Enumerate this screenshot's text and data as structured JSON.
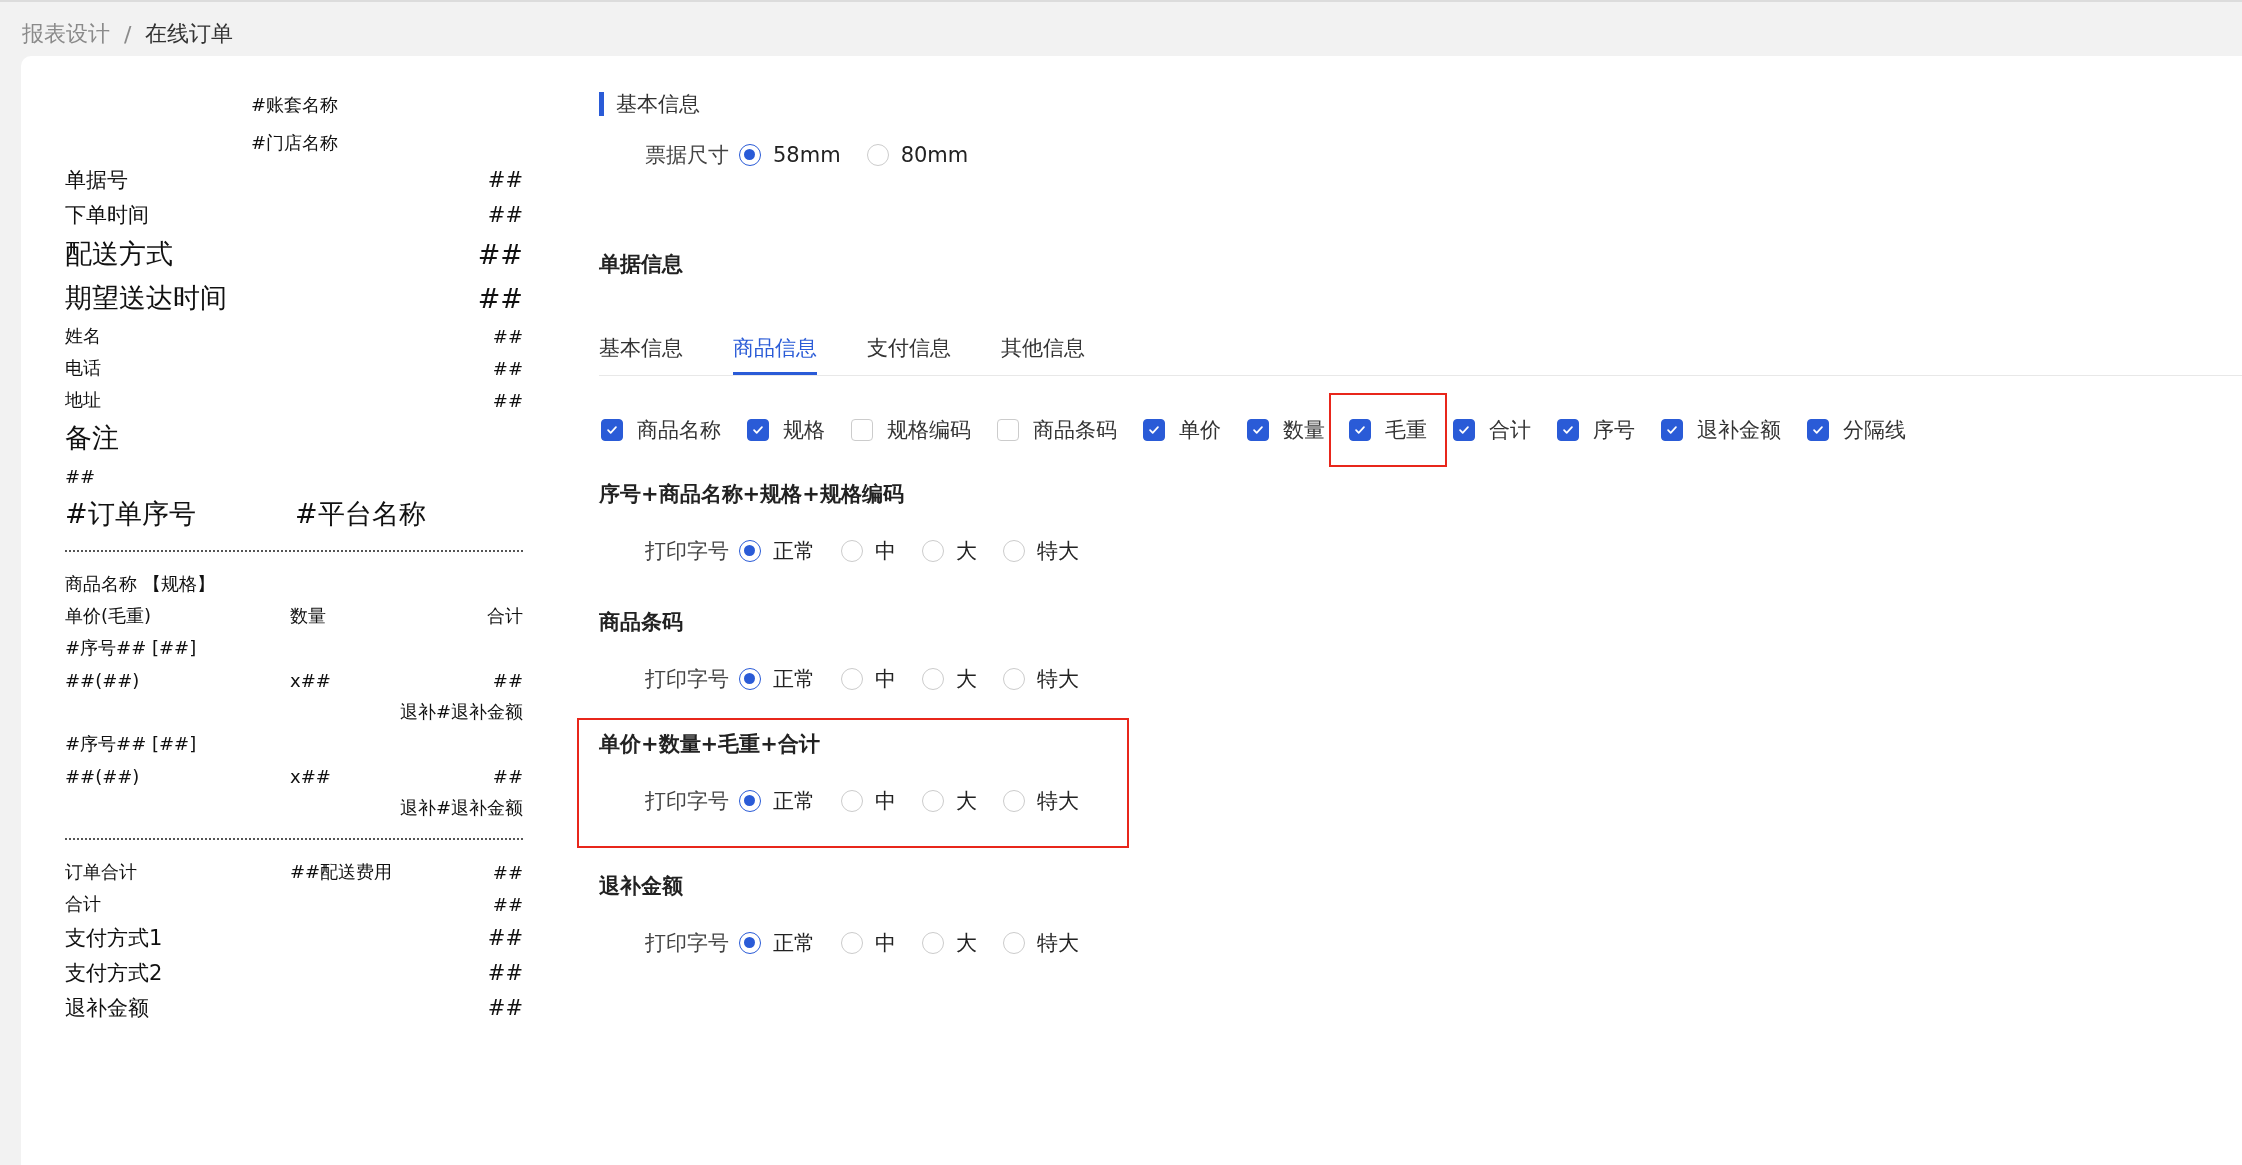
{
  "breadcrumb": [
    {
      "label": "报表设计",
      "current": false,
      "separator": "/"
    },
    {
      "label": "在线订单",
      "current": true
    }
  ],
  "preview": {
    "rows": [
      {
        "kind": "center",
        "large": false,
        "medium": false,
        "cells": [
          "#账套名称"
        ]
      },
      {
        "kind": "center",
        "large": false,
        "medium": false,
        "cells": [
          "#门店名称"
        ]
      },
      {
        "kind": "pair",
        "large": false,
        "medium": true,
        "cells": [
          "单据号",
          "##"
        ]
      },
      {
        "kind": "pair",
        "large": false,
        "medium": true,
        "cells": [
          "下单时间",
          "##"
        ]
      },
      {
        "kind": "pair",
        "large": true,
        "medium": false,
        "cells": [
          "配送方式",
          "##"
        ]
      },
      {
        "kind": "pair",
        "large": true,
        "medium": false,
        "cells": [
          "期望送达时间",
          "##"
        ]
      },
      {
        "kind": "pair",
        "large": false,
        "medium": false,
        "cells": [
          "姓名",
          "##"
        ]
      },
      {
        "kind": "pair",
        "large": false,
        "medium": false,
        "cells": [
          "电话",
          "##"
        ]
      },
      {
        "kind": "pair",
        "large": false,
        "medium": false,
        "cells": [
          "地址",
          "##"
        ]
      },
      {
        "kind": "single",
        "large": true,
        "medium": false,
        "cells": [
          "备注"
        ]
      },
      {
        "kind": "single",
        "large": false,
        "medium": false,
        "cells": [
          "##"
        ]
      },
      {
        "kind": "two",
        "large": true,
        "medium": false,
        "cells": [
          "#订单序号",
          "#平台名称"
        ]
      },
      {
        "kind": "divider"
      },
      {
        "kind": "single",
        "large": false,
        "medium": false,
        "cells": [
          "商品名称 【规格】"
        ]
      },
      {
        "kind": "triple",
        "large": false,
        "medium": false,
        "cells": [
          "单价(毛重)",
          "数量",
          "合计"
        ]
      },
      {
        "kind": "single",
        "large": false,
        "medium": false,
        "cells": [
          "#序号## [##]"
        ]
      },
      {
        "kind": "triple",
        "large": false,
        "medium": false,
        "cells": [
          "##(##)",
          "x##",
          "##"
        ]
      },
      {
        "kind": "right",
        "large": false,
        "medium": false,
        "cells": [
          "退补#退补金额"
        ]
      },
      {
        "kind": "single",
        "large": false,
        "medium": false,
        "cells": [
          "#序号## [##]"
        ]
      },
      {
        "kind": "triple",
        "large": false,
        "medium": false,
        "cells": [
          "##(##)",
          "x##",
          "##"
        ]
      },
      {
        "kind": "right",
        "large": false,
        "medium": false,
        "cells": [
          "退补#退补金额"
        ]
      },
      {
        "kind": "divider"
      },
      {
        "kind": "triple",
        "large": false,
        "medium": false,
        "cells": [
          "订单合计",
          "##配送费用",
          "##"
        ]
      },
      {
        "kind": "pair",
        "large": false,
        "medium": false,
        "cells": [
          "合计",
          "##"
        ]
      },
      {
        "kind": "pair",
        "large": false,
        "medium": true,
        "cells": [
          "支付方式1",
          "##"
        ]
      },
      {
        "kind": "pair",
        "large": false,
        "medium": true,
        "cells": [
          "支付方式2",
          "##"
        ]
      },
      {
        "kind": "pair",
        "large": false,
        "medium": true,
        "cells": [
          "退补金额",
          "##"
        ]
      }
    ]
  },
  "basic": {
    "title": "基本信息",
    "label": "票据尺寸",
    "options": [
      {
        "label": "58mm",
        "selected": true
      },
      {
        "label": "80mm",
        "selected": false
      }
    ]
  },
  "doc_info": {
    "title": "单据信息",
    "tabs": [
      {
        "label": "基本信息",
        "selected": false
      },
      {
        "label": "商品信息",
        "selected": true
      },
      {
        "label": "支付信息",
        "selected": false
      },
      {
        "label": "其他信息",
        "selected": false
      }
    ],
    "fields": [
      {
        "label": "商品名称",
        "checked": true,
        "highlighted": false
      },
      {
        "label": "规格",
        "checked": true,
        "highlighted": false
      },
      {
        "label": "规格编码",
        "checked": false,
        "highlighted": false
      },
      {
        "label": "商品条码",
        "checked": false,
        "highlighted": false
      },
      {
        "label": "单价",
        "checked": true,
        "highlighted": false
      },
      {
        "label": "数量",
        "checked": true,
        "highlighted": false
      },
      {
        "label": "毛重",
        "checked": true,
        "highlighted": true
      },
      {
        "label": "合计",
        "checked": true,
        "highlighted": false
      },
      {
        "label": "序号",
        "checked": true,
        "highlighted": false
      },
      {
        "label": "退补金额",
        "checked": true,
        "highlighted": false
      },
      {
        "label": "分隔线",
        "checked": true,
        "highlighted": false
      }
    ],
    "sections": [
      {
        "title": "序号+商品名称+规格+规格编码",
        "highlighted": false,
        "label": "打印字号",
        "options": [
          {
            "label": "正常",
            "selected": true
          },
          {
            "label": "中",
            "selected": false
          },
          {
            "label": "大",
            "selected": false
          },
          {
            "label": "特大",
            "selected": false
          }
        ]
      },
      {
        "title": "商品条码",
        "highlighted": false,
        "label": "打印字号",
        "options": [
          {
            "label": "正常",
            "selected": true
          },
          {
            "label": "中",
            "selected": false
          },
          {
            "label": "大",
            "selected": false
          },
          {
            "label": "特大",
            "selected": false
          }
        ]
      },
      {
        "title": "单价+数量+毛重+合计",
        "highlighted": true,
        "label": "打印字号",
        "options": [
          {
            "label": "正常",
            "selected": true
          },
          {
            "label": "中",
            "selected": false
          },
          {
            "label": "大",
            "selected": false
          },
          {
            "label": "特大",
            "selected": false
          }
        ]
      },
      {
        "title": "退补金额",
        "highlighted": false,
        "label": "打印字号",
        "options": [
          {
            "label": "正常",
            "selected": true
          },
          {
            "label": "中",
            "selected": false
          },
          {
            "label": "大",
            "selected": false
          },
          {
            "label": "特大",
            "selected": false
          }
        ]
      }
    ]
  }
}
